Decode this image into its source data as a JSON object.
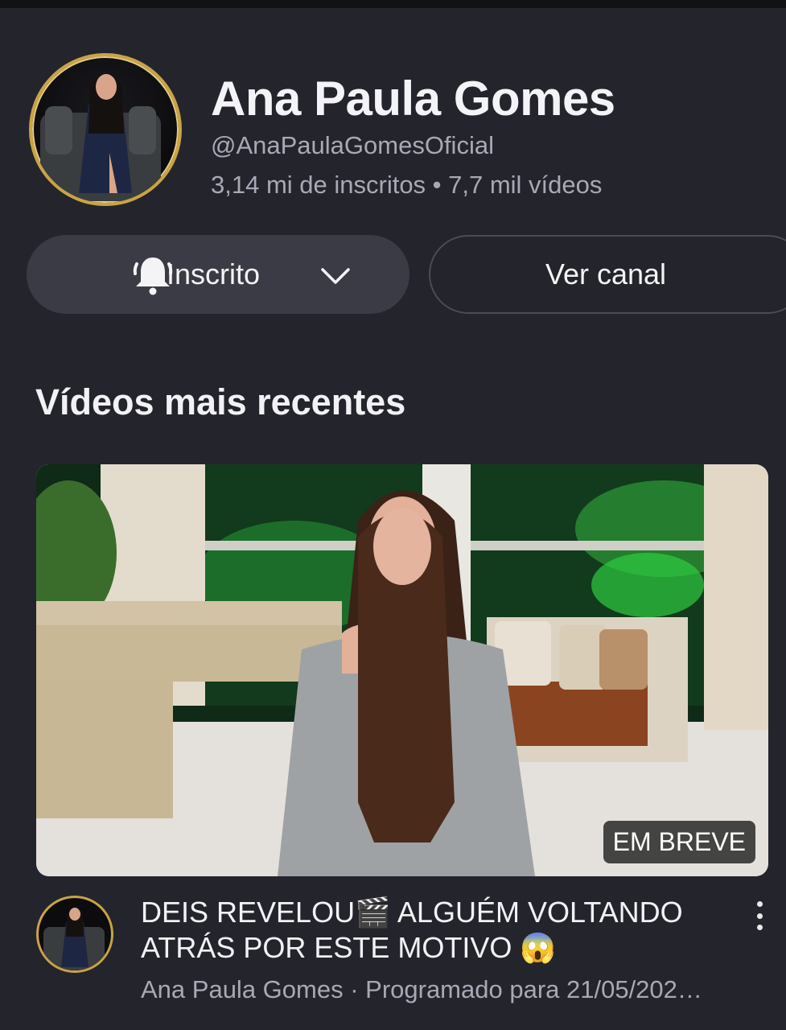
{
  "channel": {
    "name": "Ana Paula Gomes",
    "handle": "@AnaPaulaGomesOficial",
    "stats": "3,14 mi de inscritos • 7,7 mil vídeos"
  },
  "actions": {
    "subscribed_label": "Inscrito",
    "view_channel_label": "Ver canal"
  },
  "section": {
    "title": "Vídeos mais recentes"
  },
  "video": {
    "title": "DEIS REVELOU🎬 ALGUÉM VOLTANDO ATRÁS POR ESTE MOTIVO 😱",
    "meta": "Ana Paula Gomes · Programado para 21/05/202…",
    "badge": "EM BREVE"
  },
  "colors": {
    "background": "#24242c",
    "button_fill": "#3b3b45",
    "avatar_ring": "#c9a445",
    "secondary_text": "#a9a9b6"
  },
  "icons": {
    "bell": "bell-icon",
    "chevron": "chevron-down-icon",
    "more": "more-vert-icon"
  }
}
